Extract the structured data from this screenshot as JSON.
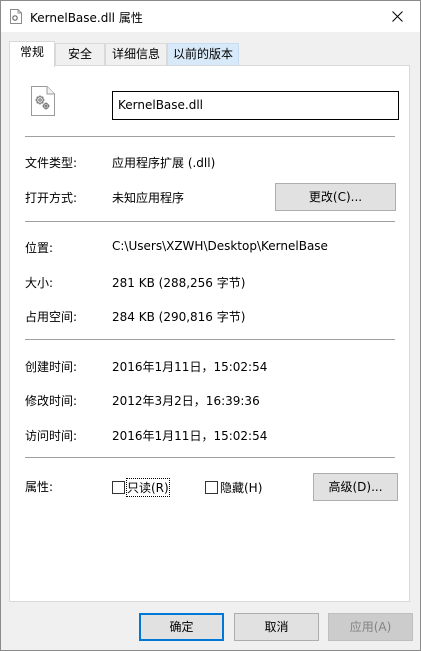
{
  "window": {
    "title": "KernelBase.dll 属性",
    "close_glyph": "✕"
  },
  "tabs": [
    {
      "label": "常规",
      "active": true
    },
    {
      "label": "安全",
      "active": false
    },
    {
      "label": "详细信息",
      "active": false
    },
    {
      "label": "以前的版本",
      "active": false
    }
  ],
  "general": {
    "file_name": "KernelBase.dll",
    "file_icon": "dll-gear-file-icon",
    "file_type_label": "文件类型:",
    "file_type_value": "应用程序扩展 (.dll)",
    "opens_with_label": "打开方式:",
    "opens_with_value": "未知应用程序",
    "change_button": "更改(C)...",
    "location_label": "位置:",
    "location_value": "C:\\Users\\XZWH\\Desktop\\KernelBase",
    "size_label": "大小:",
    "size_value": "281 KB (288,256 字节)",
    "size_on_disk_label": "占用空间:",
    "size_on_disk_value": "284 KB (290,816 字节)",
    "created_label": "创建时间:",
    "created_value": "2016年1月11日，15:02:54",
    "modified_label": "修改时间:",
    "modified_value": "2012年3月2日，16:39:36",
    "accessed_label": "访问时间:",
    "accessed_value": "2016年1月11日，15:02:54",
    "attributes_label": "属性:",
    "readonly_label": "只读(R)",
    "readonly_checked": false,
    "hidden_label": "隐藏(H)",
    "hidden_checked": false,
    "advanced_button": "高级(D)..."
  },
  "footer": {
    "ok_button": "确定",
    "cancel_button": "取消",
    "apply_button": "应用(A)"
  },
  "colors": {
    "accent": "#0078d7",
    "window_bg": "#f0f0f0",
    "panel_bg": "#ffffff",
    "button_bg": "#e1e1e1",
    "disabled_text": "#838383"
  }
}
